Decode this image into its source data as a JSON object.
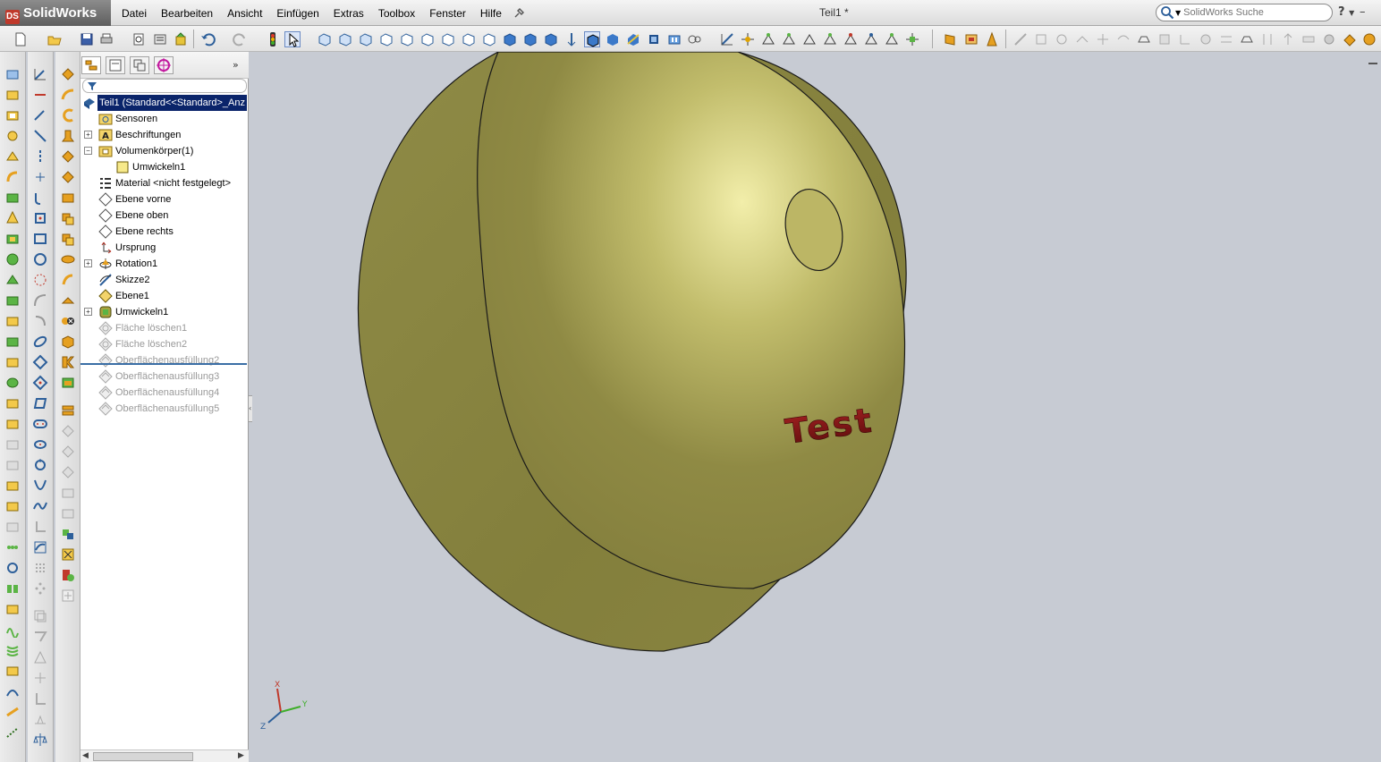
{
  "app": {
    "name": "SolidWorks",
    "logo_badge": "DS"
  },
  "menu": {
    "items": [
      "Datei",
      "Bearbeiten",
      "Ansicht",
      "Einfügen",
      "Extras",
      "Toolbox",
      "Fenster",
      "Hilfe"
    ]
  },
  "window": {
    "title": "Teil1 *"
  },
  "search": {
    "placeholder": "SolidWorks Suche",
    "help": "?"
  },
  "feature_manager": {
    "tree": [
      {
        "label": "Teil1  (Standard<<Standard>_Anz",
        "state": "selected",
        "icon": "part-icon"
      },
      {
        "label": "Sensoren",
        "icon": "sensor-folder-icon"
      },
      {
        "label": "Beschriftungen",
        "icon": "annotations-icon",
        "expandable": "+"
      },
      {
        "label": "Volumenkörper(1)",
        "icon": "solid-bodies-folder-icon",
        "expandable": "−"
      },
      {
        "label": "Umwickeln1",
        "icon": "solid-body-icon"
      },
      {
        "label": "Material <nicht festgelegt>",
        "icon": "material-icon"
      },
      {
        "label": "Ebene vorne",
        "icon": "plane-icon"
      },
      {
        "label": "Ebene oben",
        "icon": "plane-icon"
      },
      {
        "label": "Ebene rechts",
        "icon": "plane-icon"
      },
      {
        "label": "Ursprung",
        "icon": "origin-icon"
      },
      {
        "label": "Rotation1",
        "icon": "revolve-icon",
        "expandable": "+"
      },
      {
        "label": "Skizze2",
        "icon": "sketch-icon"
      },
      {
        "label": "Ebene1",
        "icon": "plane-yellow-icon"
      },
      {
        "label": "Umwickeln1",
        "icon": "wrap-feature-icon",
        "expandable": "+"
      },
      {
        "label": "Fläche löschen1",
        "icon": "delete-face-icon",
        "state": "suppressed"
      },
      {
        "label": "Fläche löschen2",
        "icon": "delete-face-icon",
        "state": "suppressed"
      },
      {
        "label": "Oberflächenausfüllung2",
        "icon": "surface-fill-icon",
        "state": "suppressed"
      },
      {
        "label": "Oberflächenausfüllung3",
        "icon": "surface-fill-icon",
        "state": "suppressed"
      },
      {
        "label": "Oberflächenausfüllung4",
        "icon": "surface-fill-icon",
        "state": "suppressed"
      },
      {
        "label": "Oberflächenausfüllung5",
        "icon": "surface-fill-icon",
        "state": "suppressed"
      }
    ]
  },
  "model": {
    "embossed_text": "Test",
    "body_color": "#8a8644",
    "text_color": "#7a1414"
  },
  "triad": {
    "x": "X",
    "y": "Y",
    "z": "Z"
  },
  "colors": {
    "viewport_bg": "#c7cbd3",
    "selection": "#0a246a",
    "suppressed_text": "#9a9a9a"
  }
}
